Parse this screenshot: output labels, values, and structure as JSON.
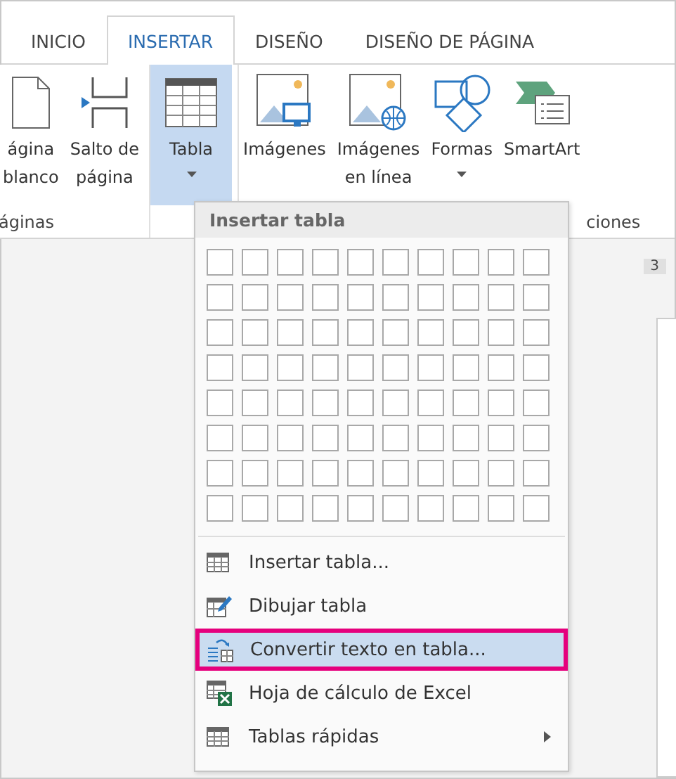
{
  "tabs": [
    {
      "label": "INICIO",
      "selected": false
    },
    {
      "label": "INSERTAR",
      "selected": true
    },
    {
      "label": "DISEÑO",
      "selected": false
    },
    {
      "label": "DISEÑO DE PÁGINA",
      "selected": false
    }
  ],
  "ribbon": {
    "groups": [
      {
        "label": "áginas",
        "buttons": [
          {
            "kind": "blank-page",
            "lines": [
              "ágina",
              "blanco"
            ],
            "has_menu": false,
            "selected": false
          },
          {
            "kind": "page-break",
            "lines": [
              "Salto de",
              "página"
            ],
            "has_menu": false,
            "selected": false
          }
        ]
      },
      {
        "buttons": [
          {
            "kind": "table",
            "lines": [
              "Tabla"
            ],
            "has_menu": true,
            "selected": true
          }
        ]
      },
      {
        "label": "ciones",
        "buttons": [
          {
            "kind": "pictures",
            "lines": [
              "Imágenes"
            ],
            "has_menu": false,
            "selected": false
          },
          {
            "kind": "online-pictures",
            "lines": [
              "Imágenes",
              "en línea"
            ],
            "has_menu": false,
            "selected": false
          },
          {
            "kind": "shapes",
            "lines": [
              "Formas"
            ],
            "has_menu": true,
            "selected": false
          },
          {
            "kind": "smartart",
            "lines": [
              "SmartArt"
            ],
            "has_menu": false,
            "selected": false
          }
        ]
      }
    ]
  },
  "page_number": "3",
  "menu": {
    "header": "Insertar tabla",
    "items": [
      {
        "kind": "insert-table",
        "label": "Insertar tabla...",
        "selected": false,
        "has_submenu": false
      },
      {
        "kind": "draw-table",
        "label": "Dibujar tabla",
        "selected": false,
        "has_submenu": false
      },
      {
        "kind": "convert",
        "label": "Convertir texto en tabla...",
        "selected": true,
        "has_submenu": false
      },
      {
        "kind": "excel",
        "label": "Hoja de cálculo de Excel",
        "selected": false,
        "has_submenu": false
      },
      {
        "kind": "quick-tables",
        "label": "Tablas rápidas",
        "selected": false,
        "has_submenu": true
      }
    ]
  }
}
